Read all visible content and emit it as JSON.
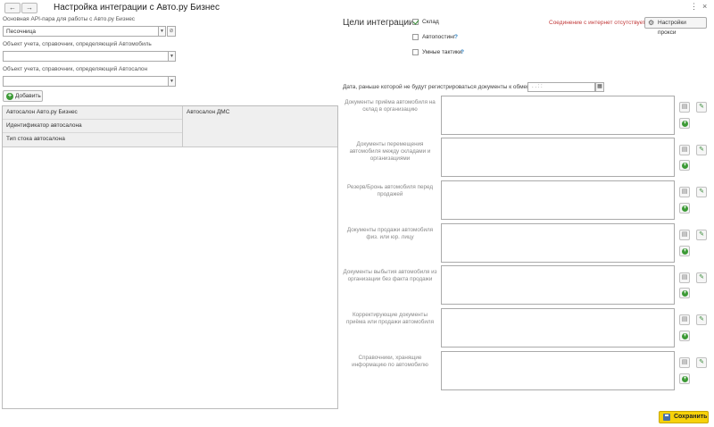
{
  "window": {
    "title": "Настройка интеграции с Авто.ру Бизнес",
    "back": "←",
    "forward": "→",
    "more": "⋮",
    "close": "×"
  },
  "left": {
    "api_label": "Основная API-пара для работы с Авто.ру Бизнес",
    "api_value": "Песочница",
    "car_object_label": "Объект учета, справочник, определяющий Автомобиль",
    "car_object_value": "",
    "salon_object_label": "Объект учета, справочник, определяющий Автосалон",
    "salon_object_value": "",
    "add_button": "Добавить",
    "grid": {
      "col1": [
        "Автосалон Авто.ру Бизнес",
        "Идентификатор автосалона",
        "Тип стока автосалона"
      ],
      "col2": "Автосалон ДМС"
    }
  },
  "right": {
    "goals_title": "Цели интеграции:",
    "checkboxes": [
      {
        "label": "Склад",
        "checked": true
      },
      {
        "label": "Автопостинг",
        "checked": false
      },
      {
        "label": "Умные тактики",
        "checked": false
      }
    ],
    "help_mark": "?",
    "connection_status": "Соединение с интернет отсутствует",
    "proxy_button": "Настройки прокси",
    "date_label": "Дата, раньше которой не будут регистрироваться документы к обмену:",
    "date_value": ". .   :  :",
    "documents": [
      "Документы приёма автомобиля на склад в организацию",
      "Документы перемещения автомобиля между складами и организациями",
      "Резерв/Бронь автомобиля перед продажей",
      "Документы продажи автомобиля физ. или юр. лицу",
      "Документы выбытия автомобиля из организации без факта продажи",
      "Корректирующие документы приёма или продажи автомобиля",
      "Справочники, хранящие информацию по автомобилю"
    ]
  },
  "footer": {
    "save_button": "Сохранить"
  },
  "colors": {
    "accent_save": "#f7d20a",
    "warning": "#c23a3a",
    "add_green": "#3c9a36"
  }
}
